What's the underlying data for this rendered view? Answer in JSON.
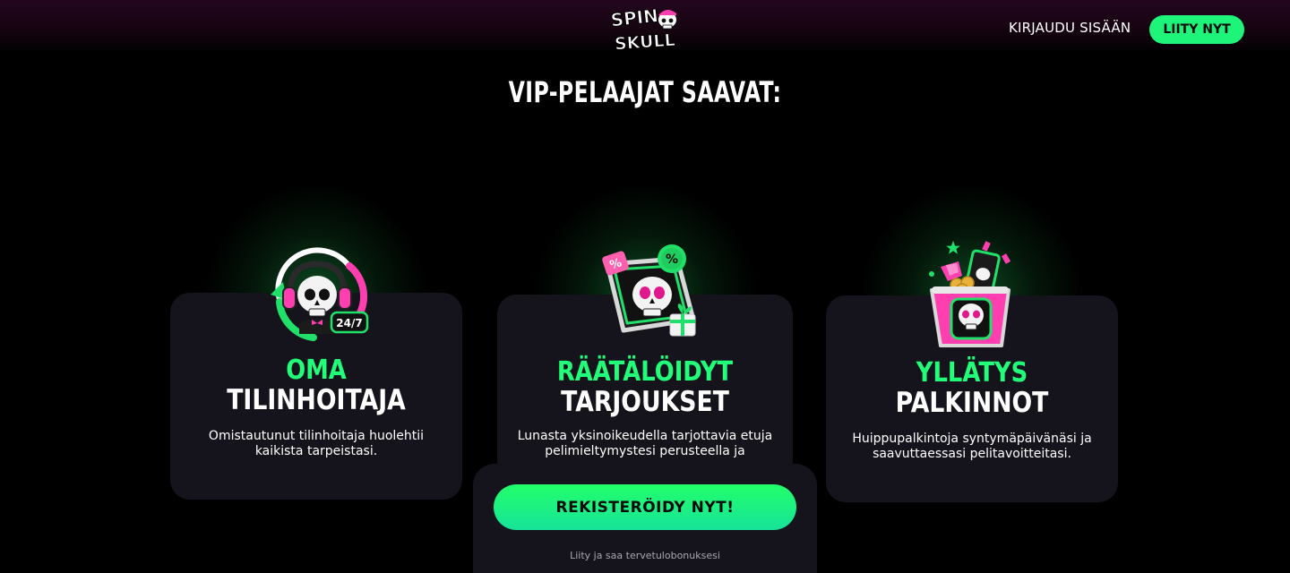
{
  "header": {
    "logo_text_line1": "SPIN",
    "logo_text_line2": "SKULL",
    "login_label": "KIRJAUDU SISÄÄN",
    "join_label": "LIITY NYT"
  },
  "section": {
    "title": "VIP-PELAAJAT SAAVAT:"
  },
  "cards": [
    {
      "title_green": "OMA",
      "title_white": "TILINHOITAJA",
      "description": "Omistautunut tilinhoitaja huolehtii kaikista tarpeistasi.",
      "icon": "headset-skull-247-icon",
      "badge": "24/7"
    },
    {
      "title_green": "RÄÄTÄLÖIDYT",
      "title_white": "TARJOUKSET",
      "description": "Lunasta yksinoikeudella tarjottavia etuja pelimieltymystesi perusteella ja",
      "icon": "skull-offer-tag-icon"
    },
    {
      "title_green": "YLLÄTYS",
      "title_white": "PALKINNOT",
      "description": "Huippupalkintoja syntymäpäivänäsi ja saavuttaessasi pelitavoitteitasi.",
      "icon": "skull-gift-basket-icon"
    }
  ],
  "cta": {
    "button_label": "REKISTERÖIDY NYT!",
    "subtext": "Liity ja saa tervetulobonuksesi"
  },
  "colors": {
    "accent_green": "#21ff7a",
    "accent_pink": "#ff3fb0",
    "card_bg": "#15141c",
    "page_bg": "#000000"
  }
}
